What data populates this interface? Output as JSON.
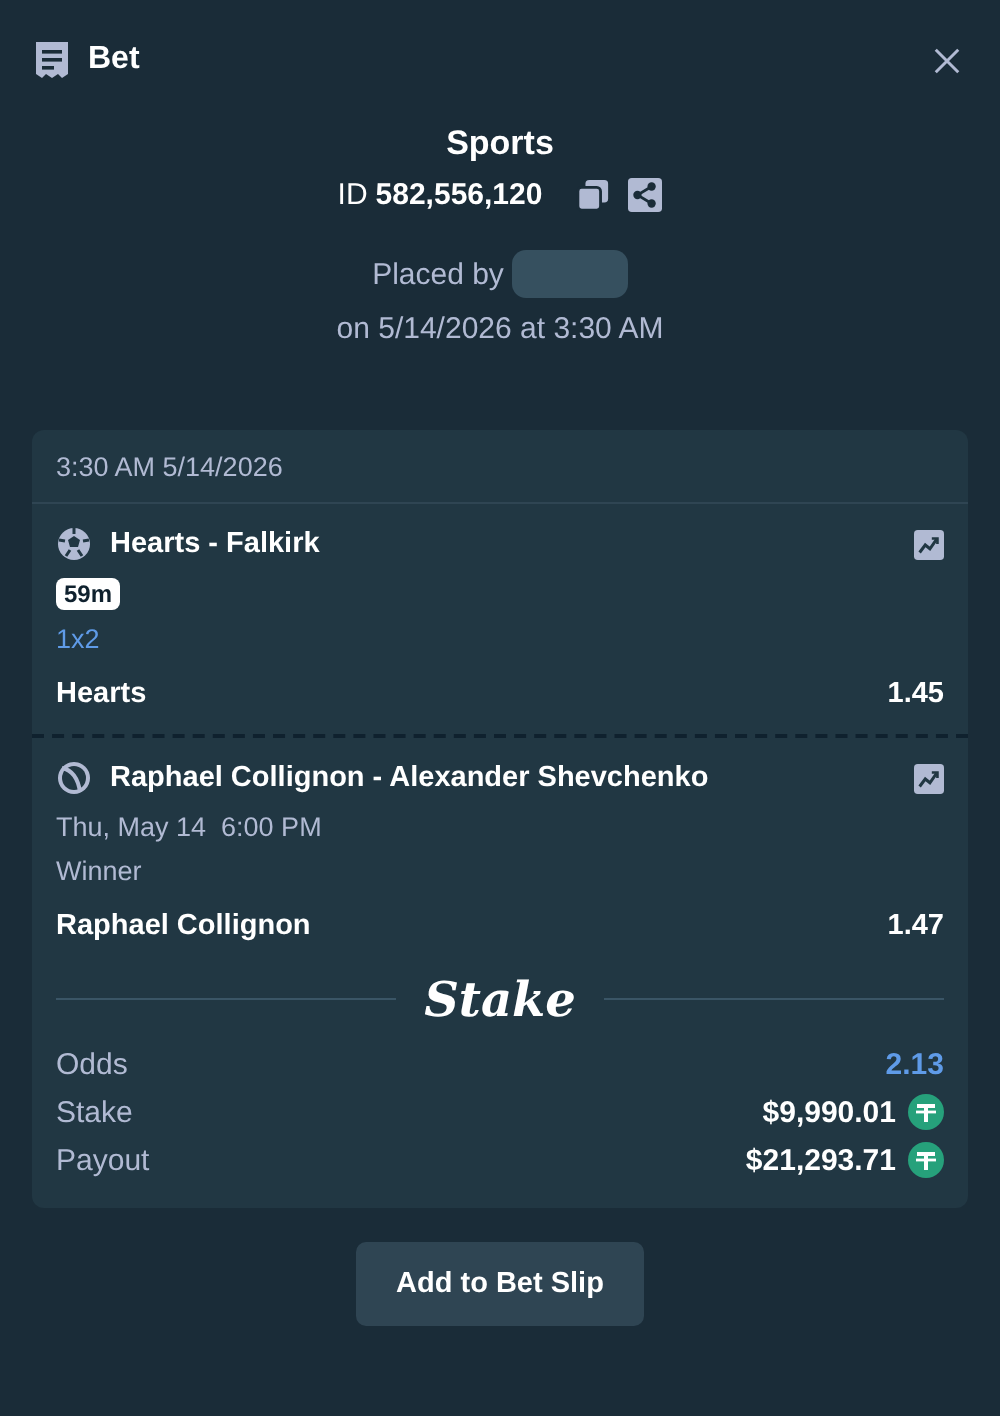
{
  "header": {
    "title": "Bet"
  },
  "summary": {
    "category": "Sports",
    "id_label": "ID",
    "id_value": "582,556,120",
    "placed_by": "Placed by",
    "placed_on": "on 5/14/2026 at 3:30 AM"
  },
  "card": {
    "timestamp": "3:30 AM 5/14/2026",
    "legs": [
      {
        "kind": "soccer",
        "event": "Hearts - Falkirk",
        "badge": "59m",
        "market": "1x2",
        "market_highlighted": true,
        "selection": "Hearts",
        "odds": "1.45"
      },
      {
        "kind": "tennis",
        "event": "Raphael Collignon - Alexander Shevchenko",
        "time": "Thu, May 14  6:00 PM",
        "market": "Winner",
        "market_highlighted": false,
        "selection": "Raphael Collignon",
        "odds": "1.47"
      }
    ],
    "brand": "Stake",
    "totals": [
      {
        "kind": "odds",
        "label": "Odds",
        "value": "2.13"
      },
      {
        "kind": "amount",
        "label": "Stake",
        "value": "$9,990.01"
      },
      {
        "kind": "amount",
        "label": "Payout",
        "value": "$21,293.71"
      }
    ]
  },
  "button": "Add to Bet Slip"
}
